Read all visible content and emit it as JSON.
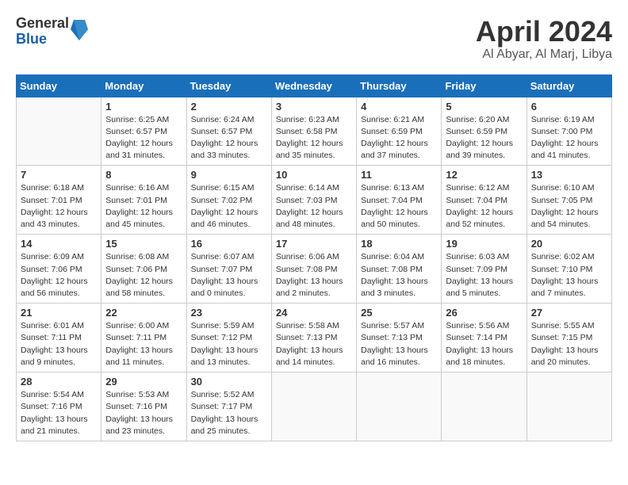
{
  "logo": {
    "general": "General",
    "blue": "Blue"
  },
  "header": {
    "month": "April 2024",
    "location": "Al Abyar, Al Marj, Libya"
  },
  "weekdays": [
    "Sunday",
    "Monday",
    "Tuesday",
    "Wednesday",
    "Thursday",
    "Friday",
    "Saturday"
  ],
  "weeks": [
    [
      {
        "day": null,
        "info": null
      },
      {
        "day": "1",
        "info": "Sunrise: 6:25 AM\nSunset: 6:57 PM\nDaylight: 12 hours\nand 31 minutes."
      },
      {
        "day": "2",
        "info": "Sunrise: 6:24 AM\nSunset: 6:57 PM\nDaylight: 12 hours\nand 33 minutes."
      },
      {
        "day": "3",
        "info": "Sunrise: 6:23 AM\nSunset: 6:58 PM\nDaylight: 12 hours\nand 35 minutes."
      },
      {
        "day": "4",
        "info": "Sunrise: 6:21 AM\nSunset: 6:59 PM\nDaylight: 12 hours\nand 37 minutes."
      },
      {
        "day": "5",
        "info": "Sunrise: 6:20 AM\nSunset: 6:59 PM\nDaylight: 12 hours\nand 39 minutes."
      },
      {
        "day": "6",
        "info": "Sunrise: 6:19 AM\nSunset: 7:00 PM\nDaylight: 12 hours\nand 41 minutes."
      }
    ],
    [
      {
        "day": "7",
        "info": "Sunrise: 6:18 AM\nSunset: 7:01 PM\nDaylight: 12 hours\nand 43 minutes."
      },
      {
        "day": "8",
        "info": "Sunrise: 6:16 AM\nSunset: 7:01 PM\nDaylight: 12 hours\nand 45 minutes."
      },
      {
        "day": "9",
        "info": "Sunrise: 6:15 AM\nSunset: 7:02 PM\nDaylight: 12 hours\nand 46 minutes."
      },
      {
        "day": "10",
        "info": "Sunrise: 6:14 AM\nSunset: 7:03 PM\nDaylight: 12 hours\nand 48 minutes."
      },
      {
        "day": "11",
        "info": "Sunrise: 6:13 AM\nSunset: 7:04 PM\nDaylight: 12 hours\nand 50 minutes."
      },
      {
        "day": "12",
        "info": "Sunrise: 6:12 AM\nSunset: 7:04 PM\nDaylight: 12 hours\nand 52 minutes."
      },
      {
        "day": "13",
        "info": "Sunrise: 6:10 AM\nSunset: 7:05 PM\nDaylight: 12 hours\nand 54 minutes."
      }
    ],
    [
      {
        "day": "14",
        "info": "Sunrise: 6:09 AM\nSunset: 7:06 PM\nDaylight: 12 hours\nand 56 minutes."
      },
      {
        "day": "15",
        "info": "Sunrise: 6:08 AM\nSunset: 7:06 PM\nDaylight: 12 hours\nand 58 minutes."
      },
      {
        "day": "16",
        "info": "Sunrise: 6:07 AM\nSunset: 7:07 PM\nDaylight: 13 hours\nand 0 minutes."
      },
      {
        "day": "17",
        "info": "Sunrise: 6:06 AM\nSunset: 7:08 PM\nDaylight: 13 hours\nand 2 minutes."
      },
      {
        "day": "18",
        "info": "Sunrise: 6:04 AM\nSunset: 7:08 PM\nDaylight: 13 hours\nand 3 minutes."
      },
      {
        "day": "19",
        "info": "Sunrise: 6:03 AM\nSunset: 7:09 PM\nDaylight: 13 hours\nand 5 minutes."
      },
      {
        "day": "20",
        "info": "Sunrise: 6:02 AM\nSunset: 7:10 PM\nDaylight: 13 hours\nand 7 minutes."
      }
    ],
    [
      {
        "day": "21",
        "info": "Sunrise: 6:01 AM\nSunset: 7:11 PM\nDaylight: 13 hours\nand 9 minutes."
      },
      {
        "day": "22",
        "info": "Sunrise: 6:00 AM\nSunset: 7:11 PM\nDaylight: 13 hours\nand 11 minutes."
      },
      {
        "day": "23",
        "info": "Sunrise: 5:59 AM\nSunset: 7:12 PM\nDaylight: 13 hours\nand 13 minutes."
      },
      {
        "day": "24",
        "info": "Sunrise: 5:58 AM\nSunset: 7:13 PM\nDaylight: 13 hours\nand 14 minutes."
      },
      {
        "day": "25",
        "info": "Sunrise: 5:57 AM\nSunset: 7:13 PM\nDaylight: 13 hours\nand 16 minutes."
      },
      {
        "day": "26",
        "info": "Sunrise: 5:56 AM\nSunset: 7:14 PM\nDaylight: 13 hours\nand 18 minutes."
      },
      {
        "day": "27",
        "info": "Sunrise: 5:55 AM\nSunset: 7:15 PM\nDaylight: 13 hours\nand 20 minutes."
      }
    ],
    [
      {
        "day": "28",
        "info": "Sunrise: 5:54 AM\nSunset: 7:16 PM\nDaylight: 13 hours\nand 21 minutes."
      },
      {
        "day": "29",
        "info": "Sunrise: 5:53 AM\nSunset: 7:16 PM\nDaylight: 13 hours\nand 23 minutes."
      },
      {
        "day": "30",
        "info": "Sunrise: 5:52 AM\nSunset: 7:17 PM\nDaylight: 13 hours\nand 25 minutes."
      },
      {
        "day": null,
        "info": null
      },
      {
        "day": null,
        "info": null
      },
      {
        "day": null,
        "info": null
      },
      {
        "day": null,
        "info": null
      }
    ]
  ]
}
